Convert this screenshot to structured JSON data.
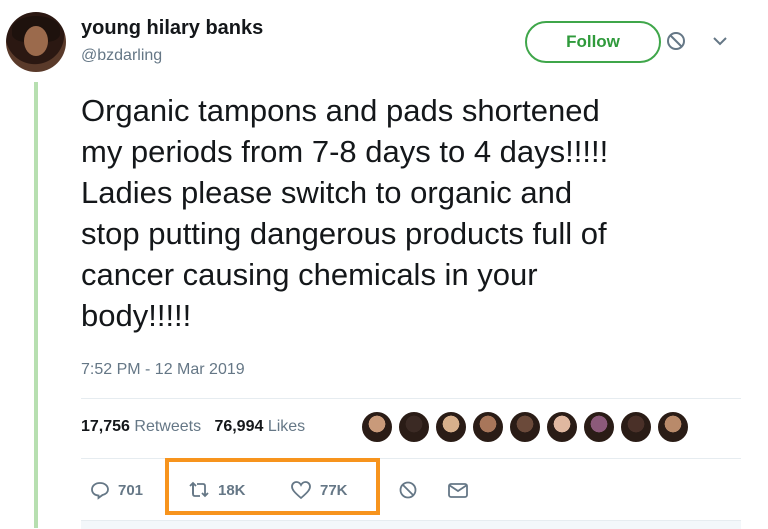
{
  "user": {
    "display_name": "young hilary banks",
    "handle": "@bzdarling"
  },
  "header": {
    "follow_label": "Follow",
    "block_icon": "block-icon",
    "menu_icon": "chevron-down-icon"
  },
  "tweet": {
    "text": "Organic tampons and pads shortened\nmy periods from 7-8 days to 4 days!!!!!\nLadies please switch to organic and\nstop putting dangerous products full of\ncancer causing chemicals in your\nbody!!!!!",
    "timestamp": "7:52 PM - 12 Mar 2019"
  },
  "stats": {
    "retweets_count": "17,756",
    "retweets_label": "Retweets",
    "likes_count": "76,994",
    "likes_label": "Likes",
    "liker_avatar_colors": [
      "#c99a7a",
      "#3b2a24",
      "#d8b08c",
      "#a8765a",
      "#6b4a3a",
      "#e0b8a0",
      "#8c5a7a",
      "#4a3028",
      "#b98a6a"
    ]
  },
  "actions": {
    "reply_count": "701",
    "retweet_count": "18K",
    "like_count": "77K",
    "highlight_color": "#f7941d",
    "accent_color": "#3fa64a"
  }
}
